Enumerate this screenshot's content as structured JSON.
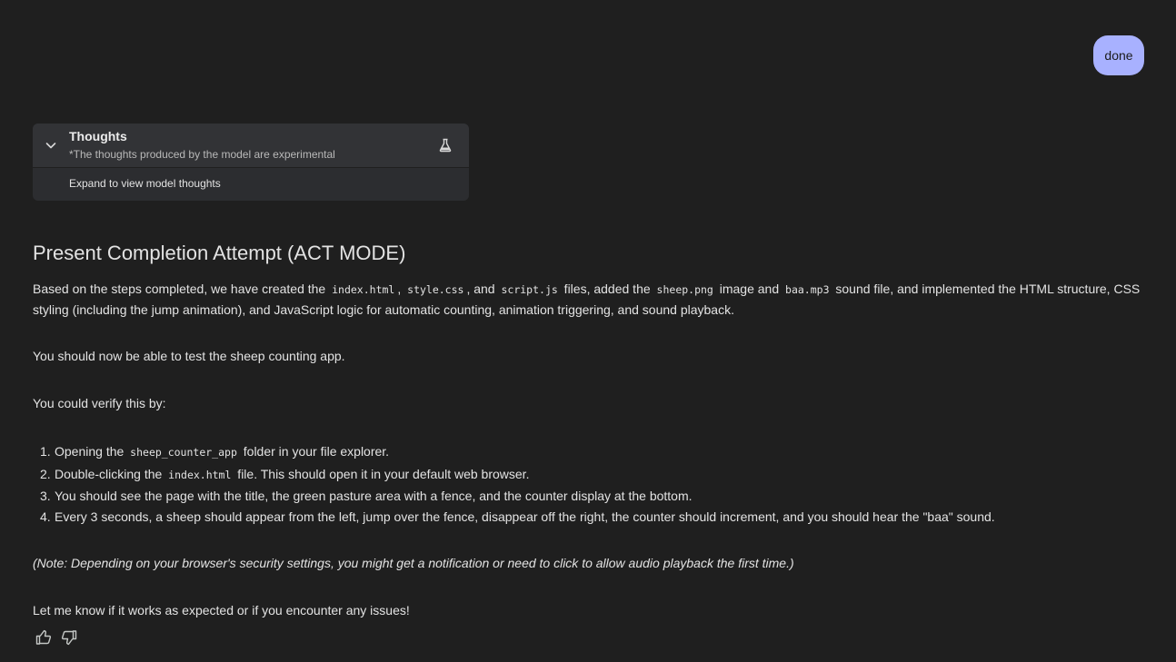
{
  "user_message": "done",
  "thoughts": {
    "title": "Thoughts",
    "subtitle": "*The thoughts produced by the model are experimental",
    "expand_label": "Expand to view model thoughts"
  },
  "response": {
    "heading": "Present Completion Attempt (ACT MODE)",
    "p1": {
      "t1": "Based on the steps completed, we have created the ",
      "c1": "index.html",
      "t2": ", ",
      "c2": "style.css",
      "t3": ", and ",
      "c3": "script.js",
      "t4": " files, added the ",
      "c4": "sheep.png",
      "t5": " image and ",
      "c5": "baa.mp3",
      "t6": " sound file, and implemented the HTML structure, CSS styling (including the jump animation), and JavaScript logic for automatic counting, animation triggering, and sound playback."
    },
    "p2": "You should now be able to test the sheep counting app.",
    "p3": "You could verify this by:",
    "steps": [
      {
        "num": "1.",
        "t1": "Opening the ",
        "code": "sheep_counter_app",
        "t2": " folder in your file explorer."
      },
      {
        "num": "2.",
        "t1": "Double-clicking the ",
        "code": "index.html",
        "t2": " file. This should open it in your default web browser."
      },
      {
        "num": "3.",
        "t1": "You should see the page with the title, the green pasture area with a fence, and the counter display at the bottom."
      },
      {
        "num": "4.",
        "t1": "Every 3 seconds, a sheep should appear from the left, jump over the fence, disappear off the right, the counter should increment, and you should hear the \"baa\" sound."
      }
    ],
    "note": "(Note: Depending on your browser's security settings, you might get a notification or need to click to allow audio playback the first time.)",
    "closing": "Let me know if it works as expected or if you encounter any issues!"
  },
  "feedback": {
    "thumbs_up_icon": "thumbs-up-icon",
    "thumbs_down_icon": "thumbs-down-icon"
  },
  "colors": {
    "background": "#1f1f1f",
    "user_bubble": "#a8b1ff",
    "thoughts_panel": "#2c2d30",
    "text": "#e3e3e3"
  }
}
